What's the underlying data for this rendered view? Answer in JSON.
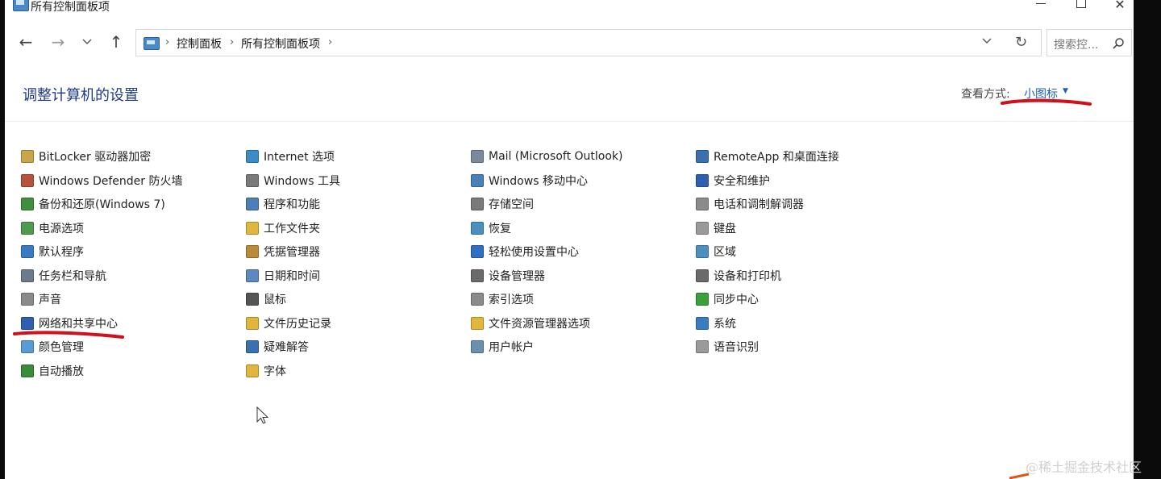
{
  "window": {
    "title": "所有控制面板项",
    "minimize_glyph": "—",
    "maximize_glyph": "☐",
    "close_glyph": "✕"
  },
  "navbar": {
    "back_glyph": "←",
    "forward_glyph": "→",
    "recent_glyph": "⌄",
    "up_glyph": "↑",
    "breadcrumbs": [
      "控制面板",
      "所有控制面板项"
    ],
    "separator": "›",
    "dropdown_glyph": "⌄",
    "refresh_glyph": "↻",
    "search_placeholder": "搜索控...",
    "search_glyph": "⌕"
  },
  "header": {
    "title": "调整计算机的设置",
    "view_by_label": "查看方式:",
    "view_by_value": "小图标",
    "view_by_caret": "▼"
  },
  "columns": [
    {
      "items": [
        {
          "label": "BitLocker 驱动器加密",
          "icon": "bitlocker-key-icon",
          "color": "#c9a64a"
        },
        {
          "label": "Windows Defender 防火墙",
          "icon": "firewall-brick-icon",
          "color": "#b5533c"
        },
        {
          "label": "备份和还原(Windows 7)",
          "icon": "backup-icon",
          "color": "#3f8f3f"
        },
        {
          "label": "电源选项",
          "icon": "power-battery-icon",
          "color": "#4f9a4f"
        },
        {
          "label": "默认程序",
          "icon": "default-programs-icon",
          "color": "#3a7cc2"
        },
        {
          "label": "任务栏和导航",
          "icon": "taskbar-icon",
          "color": "#6b7b8c"
        },
        {
          "label": "声音",
          "icon": "speaker-icon",
          "color": "#8a8a8a"
        },
        {
          "label": "网络和共享中心",
          "icon": "network-icon",
          "color": "#2f5fb0"
        },
        {
          "label": "颜色管理",
          "icon": "color-management-icon",
          "color": "#5a9bd4"
        },
        {
          "label": "自动播放",
          "icon": "autoplay-icon",
          "color": "#3c8a3c"
        }
      ]
    },
    {
      "items": [
        {
          "label": "Internet 选项",
          "icon": "internet-globe-icon",
          "color": "#3a8cc8"
        },
        {
          "label": "Windows 工具",
          "icon": "windows-tools-icon",
          "color": "#7a7a7a"
        },
        {
          "label": "程序和功能",
          "icon": "programs-icon",
          "color": "#4a7fb8"
        },
        {
          "label": "工作文件夹",
          "icon": "work-folder-icon",
          "color": "#e2b53c"
        },
        {
          "label": "凭据管理器",
          "icon": "credential-icon",
          "color": "#b88a3a"
        },
        {
          "label": "日期和时间",
          "icon": "clock-calendar-icon",
          "color": "#5a8ac0"
        },
        {
          "label": "鼠标",
          "icon": "mouse-icon",
          "color": "#555555"
        },
        {
          "label": "文件历史记录",
          "icon": "file-history-icon",
          "color": "#e2b53c"
        },
        {
          "label": "疑难解答",
          "icon": "troubleshoot-icon",
          "color": "#3a6fb0"
        },
        {
          "label": "字体",
          "icon": "fonts-folder-icon",
          "color": "#e2b53c"
        }
      ]
    },
    {
      "items": [
        {
          "label": "Mail (Microsoft Outlook)",
          "icon": "mail-icon",
          "color": "#7a8a9a"
        },
        {
          "label": "Windows 移动中心",
          "icon": "mobility-center-icon",
          "color": "#4a7fb8"
        },
        {
          "label": "存储空间",
          "icon": "storage-icon",
          "color": "#7a7a7a"
        },
        {
          "label": "恢复",
          "icon": "recovery-icon",
          "color": "#4a8fc0"
        },
        {
          "label": "轻松使用设置中心",
          "icon": "ease-of-access-icon",
          "color": "#2f6fc0"
        },
        {
          "label": "设备管理器",
          "icon": "device-manager-icon",
          "color": "#6a6a6a"
        },
        {
          "label": "索引选项",
          "icon": "indexing-icon",
          "color": "#8a8a8a"
        },
        {
          "label": "文件资源管理器选项",
          "icon": "explorer-options-icon",
          "color": "#e2b53c"
        },
        {
          "label": "用户帐户",
          "icon": "user-accounts-icon",
          "color": "#6a8fb0"
        }
      ]
    },
    {
      "items": [
        {
          "label": "RemoteApp 和桌面连接",
          "icon": "remoteapp-icon",
          "color": "#3a6fb0"
        },
        {
          "label": "安全和维护",
          "icon": "security-flag-icon",
          "color": "#2f5fb0"
        },
        {
          "label": "电话和调制解调器",
          "icon": "phone-modem-icon",
          "color": "#8a8a8a"
        },
        {
          "label": "键盘",
          "icon": "keyboard-icon",
          "color": "#9a9a9a"
        },
        {
          "label": "区域",
          "icon": "region-globe-icon",
          "color": "#4a8fc0"
        },
        {
          "label": "设备和打印机",
          "icon": "printer-icon",
          "color": "#6a6a6a"
        },
        {
          "label": "同步中心",
          "icon": "sync-center-icon",
          "color": "#3aa03a"
        },
        {
          "label": "系统",
          "icon": "system-icon",
          "color": "#3a7cc2"
        },
        {
          "label": "语音识别",
          "icon": "microphone-icon",
          "color": "#9a9a9a"
        }
      ]
    }
  ],
  "watermark": "@稀土掘金技术社区",
  "annotation_color": "#d0101a"
}
